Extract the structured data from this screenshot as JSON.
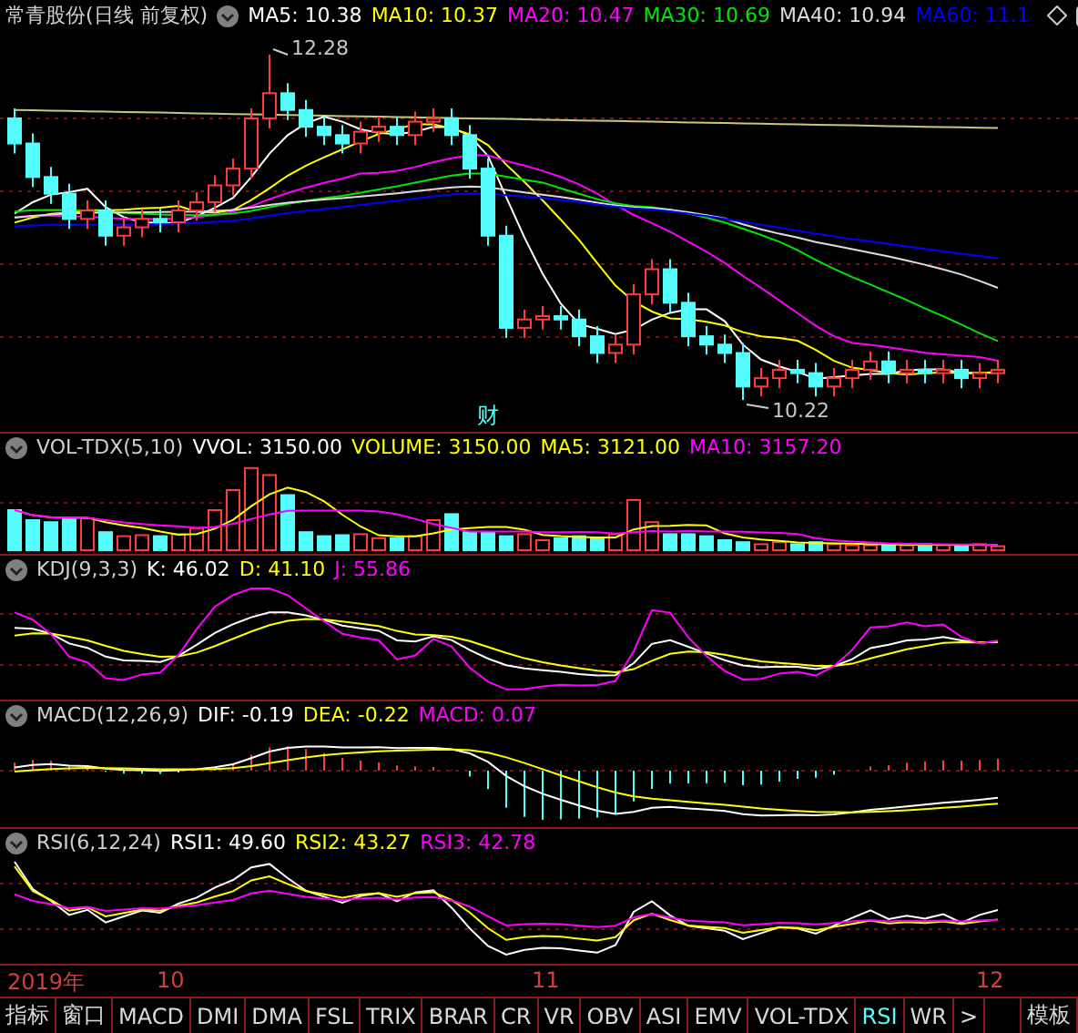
{
  "main_panel": {
    "title": "常青股份(日线 前复权)",
    "indicators": [
      {
        "label": "MA5: 10.38",
        "color": "#ffffff"
      },
      {
        "label": "MA10: 10.37",
        "color": "#ffff00"
      },
      {
        "label": "MA20: 10.47",
        "color": "#ff00ff"
      },
      {
        "label": "MA30: 10.69",
        "color": "#00e600"
      },
      {
        "label": "MA40: 10.94",
        "color": "#dcdcdc"
      },
      {
        "label": "MA60: 11.1",
        "color": "#0000ff"
      }
    ],
    "high_label": "12.28",
    "low_label": "10.22",
    "event_marker": "财"
  },
  "volume_panel": {
    "title": "VOL-TDX(5,10)",
    "indicators": [
      {
        "label": "VVOL: 3150.00",
        "color": "#ffffff"
      },
      {
        "label": "VOLUME: 3150.00",
        "color": "#ffff00"
      },
      {
        "label": "MA5: 3121.00",
        "color": "#ffff00"
      },
      {
        "label": "MA10: 3157.20",
        "color": "#ff00ff"
      }
    ]
  },
  "kdj_panel": {
    "title": "KDJ(9,3,3)",
    "indicators": [
      {
        "label": "K: 46.02",
        "color": "#ffffff"
      },
      {
        "label": "D: 41.10",
        "color": "#ffff00"
      },
      {
        "label": "J: 55.86",
        "color": "#ff00ff"
      }
    ]
  },
  "macd_panel": {
    "title": "MACD(12,26,9)",
    "indicators": [
      {
        "label": "DIF: -0.19",
        "color": "#ffffff"
      },
      {
        "label": "DEA: -0.22",
        "color": "#ffff00"
      },
      {
        "label": "MACD: 0.07",
        "color": "#ff00ff"
      }
    ]
  },
  "rsi_panel": {
    "title": "RSI(6,12,24)",
    "indicators": [
      {
        "label": "RSI1: 49.60",
        "color": "#ffffff"
      },
      {
        "label": "RSI2: 43.27",
        "color": "#ffff00"
      },
      {
        "label": "RSI3: 42.78",
        "color": "#ff00ff"
      }
    ]
  },
  "time_axis": [
    "2019年",
    "10",
    "11",
    "12"
  ],
  "tabs": [
    {
      "label": "指标",
      "selected": false
    },
    {
      "label": "窗口",
      "selected": false
    },
    {
      "label": "MACD",
      "selected": false
    },
    {
      "label": "DMI",
      "selected": false
    },
    {
      "label": "DMA",
      "selected": false
    },
    {
      "label": "FSL",
      "selected": false
    },
    {
      "label": "TRIX",
      "selected": false
    },
    {
      "label": "BRAR",
      "selected": false
    },
    {
      "label": "CR",
      "selected": false
    },
    {
      "label": "VR",
      "selected": false
    },
    {
      "label": "OBV",
      "selected": false
    },
    {
      "label": "ASI",
      "selected": false
    },
    {
      "label": "EMV",
      "selected": false
    },
    {
      "label": "VOL-TDX",
      "selected": false
    },
    {
      "label": "RSI",
      "selected": true
    },
    {
      "label": "WR",
      "selected": false
    }
  ],
  "more_button": ">",
  "template_button": "模板"
}
